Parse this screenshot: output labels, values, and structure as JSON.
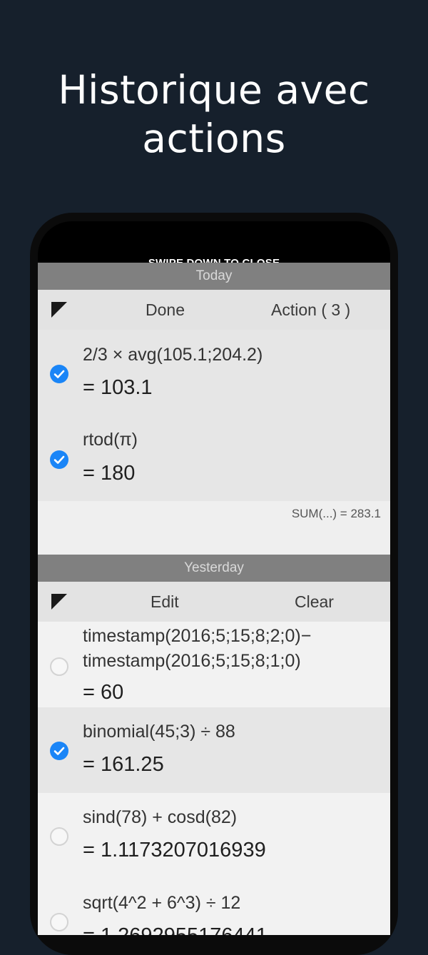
{
  "promo": {
    "title_line1": "Historique avec",
    "title_line2": "actions"
  },
  "sheet": {
    "swipe_hint": "SWIPE DOWN TO CLOSE"
  },
  "today": {
    "header": "Today",
    "toolbar": {
      "done_label": "Done",
      "action_label": "Action ( 3 )"
    },
    "entries": [
      {
        "expression": "2/3 × avg(105.1;204.2)",
        "result": "= 103.1",
        "checked": true
      },
      {
        "expression": "rtod(π)",
        "result": "= 180",
        "checked": true
      }
    ],
    "sum": "SUM(...) = 283.1"
  },
  "yesterday": {
    "header": "Yesterday",
    "toolbar": {
      "edit_label": "Edit",
      "clear_label": "Clear"
    },
    "entries": [
      {
        "expression_line1": "timestamp(2016;5;15;8;2;0)−",
        "expression_line2": "timestamp(2016;5;15;8;1;0)",
        "result": "= 60",
        "checked": false
      },
      {
        "expression": "binomial(45;3) ÷ 88",
        "result": "= 161.25",
        "checked": true
      },
      {
        "expression": "sind(78) + cosd(82)",
        "result": "= 1.1173207016939",
        "checked": false
      },
      {
        "expression": "sqrt(4^2 + 6^3) ÷ 12",
        "result": "= 1.2692955176441",
        "checked": false
      }
    ]
  },
  "colors": {
    "background": "#16202c",
    "accent": "#1a85f7",
    "section_header": "#808080"
  }
}
